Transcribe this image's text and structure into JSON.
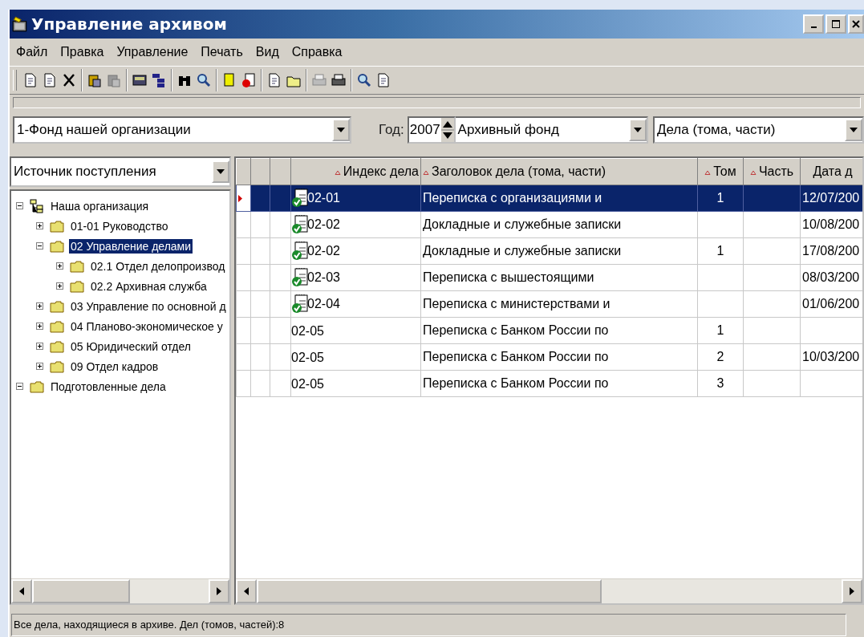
{
  "window": {
    "title": "Управление архивом"
  },
  "menu": [
    "Файл",
    "Правка",
    "Управление",
    "Печать",
    "Вид",
    "Справка"
  ],
  "filters": {
    "fund": "1-Фонд нашей организации",
    "year_label": "Год:",
    "year": "2007",
    "fund_type": "Архивный фонд",
    "view": "Дела (тома, части)"
  },
  "source_select": "Источник поступления",
  "tree": [
    {
      "label": "Наша организация",
      "kind": "root",
      "expanded": true,
      "selected": false,
      "children": [
        {
          "label": "01-01 Руководство",
          "kind": "folder",
          "expanded": false,
          "selected": false
        },
        {
          "label": "02 Управление делами",
          "kind": "folder",
          "expanded": true,
          "selected": true,
          "children": [
            {
              "label": "02.1 Отдел делопроизвод",
              "kind": "folder",
              "expanded": false,
              "selected": false
            },
            {
              "label": "02.2 Архивная служба",
              "kind": "folder",
              "expanded": false,
              "selected": false
            }
          ]
        },
        {
          "label": "03 Управление по основной д",
          "kind": "folder",
          "expanded": false,
          "selected": false
        },
        {
          "label": "04 Планово-экономическое у",
          "kind": "folder",
          "expanded": false,
          "selected": false
        },
        {
          "label": "05 Юридический отдел",
          "kind": "folder",
          "expanded": false,
          "selected": false
        },
        {
          "label": "09 Отдел кадров",
          "kind": "folder",
          "expanded": false,
          "selected": false
        }
      ]
    },
    {
      "label": "Подготовленные дела",
      "kind": "folder",
      "expanded": true,
      "selected": false
    }
  ],
  "table": {
    "columns": [
      {
        "label": "Индекс дела",
        "sort_marker": true
      },
      {
        "label": "Заголовок дела (тома, части)",
        "sort_marker": true
      },
      {
        "label": "Том",
        "sort_marker": true
      },
      {
        "label": "Часть",
        "sort_marker": true
      },
      {
        "label": "Дата д",
        "sort_marker": false
      }
    ],
    "rows": [
      {
        "selected": true,
        "signed": true,
        "index": "02-01",
        "title": "Переписка с организациями и",
        "volume": "1",
        "date": "12/07/200"
      },
      {
        "selected": false,
        "signed": true,
        "index": "02-02",
        "title": "Докладные и служебные записки",
        "date": "10/08/200"
      },
      {
        "selected": false,
        "signed": true,
        "index": "02-02",
        "title": "Докладные и служебные записки",
        "volume": "1",
        "date": "17/08/200"
      },
      {
        "selected": false,
        "signed": true,
        "index": "02-03",
        "title": "Переписка с вышестоящими",
        "date": "08/03/200"
      },
      {
        "selected": false,
        "signed": true,
        "index": "02-04",
        "title": "Переписка с министерствами и",
        "date": "01/06/200"
      },
      {
        "selected": false,
        "signed": false,
        "index": "02-05",
        "title": "Переписка с Банком России по",
        "volume": "1"
      },
      {
        "selected": false,
        "signed": false,
        "index": "02-05",
        "title": "Переписка с Банком России по",
        "volume": "2",
        "date": "10/03/200"
      },
      {
        "selected": false,
        "signed": false,
        "index": "02-05",
        "title": "Переписка с Банком России по",
        "volume": "3"
      }
    ]
  },
  "status_bar": "Все дела, находящиеся в архиве. Дел (томов, частей):8"
}
